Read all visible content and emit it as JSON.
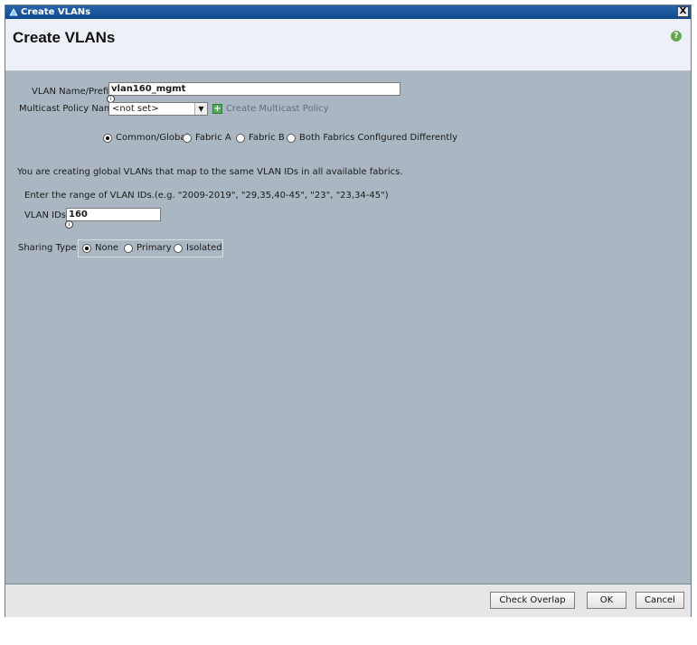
{
  "window": {
    "title": "Create VLANs",
    "close_glyph": "X"
  },
  "header": {
    "title": "Create VLANs",
    "help_icon": "question-circle-icon"
  },
  "form": {
    "vlan_name_label": "VLAN Name/Prefix:",
    "vlan_name_value": "vlan160_mgmt",
    "multicast_label": "Multicast Policy Name:",
    "multicast_value": "<not set>",
    "create_multicast_link": "Create Multicast Policy",
    "fabric_options": [
      {
        "label": "Common/Global",
        "checked": true
      },
      {
        "label": "Fabric A",
        "checked": false
      },
      {
        "label": "Fabric B",
        "checked": false
      },
      {
        "label": "Both Fabrics Configured Differently",
        "checked": false
      }
    ],
    "global_info": "You are creating global VLANs that map to the same VLAN IDs in all available fabrics.",
    "range_hint": "Enter the range of VLAN IDs.(e.g. \"2009-2019\", \"29,35,40-45\", \"23\", \"23,34-45\")",
    "vlan_ids_label": "VLAN IDs:",
    "vlan_ids_value": "160",
    "sharing_label": "Sharing Type:",
    "sharing_options": [
      {
        "label": "None",
        "checked": true
      },
      {
        "label": "Primary",
        "checked": false
      },
      {
        "label": "Isolated",
        "checked": false
      }
    ]
  },
  "footer": {
    "check_overlap": "Check Overlap",
    "ok": "OK",
    "cancel": "Cancel"
  },
  "colors": {
    "title_bar": "#1a56a0",
    "content_bg": "#aab6c2",
    "header_bg": "#edf0f6"
  }
}
